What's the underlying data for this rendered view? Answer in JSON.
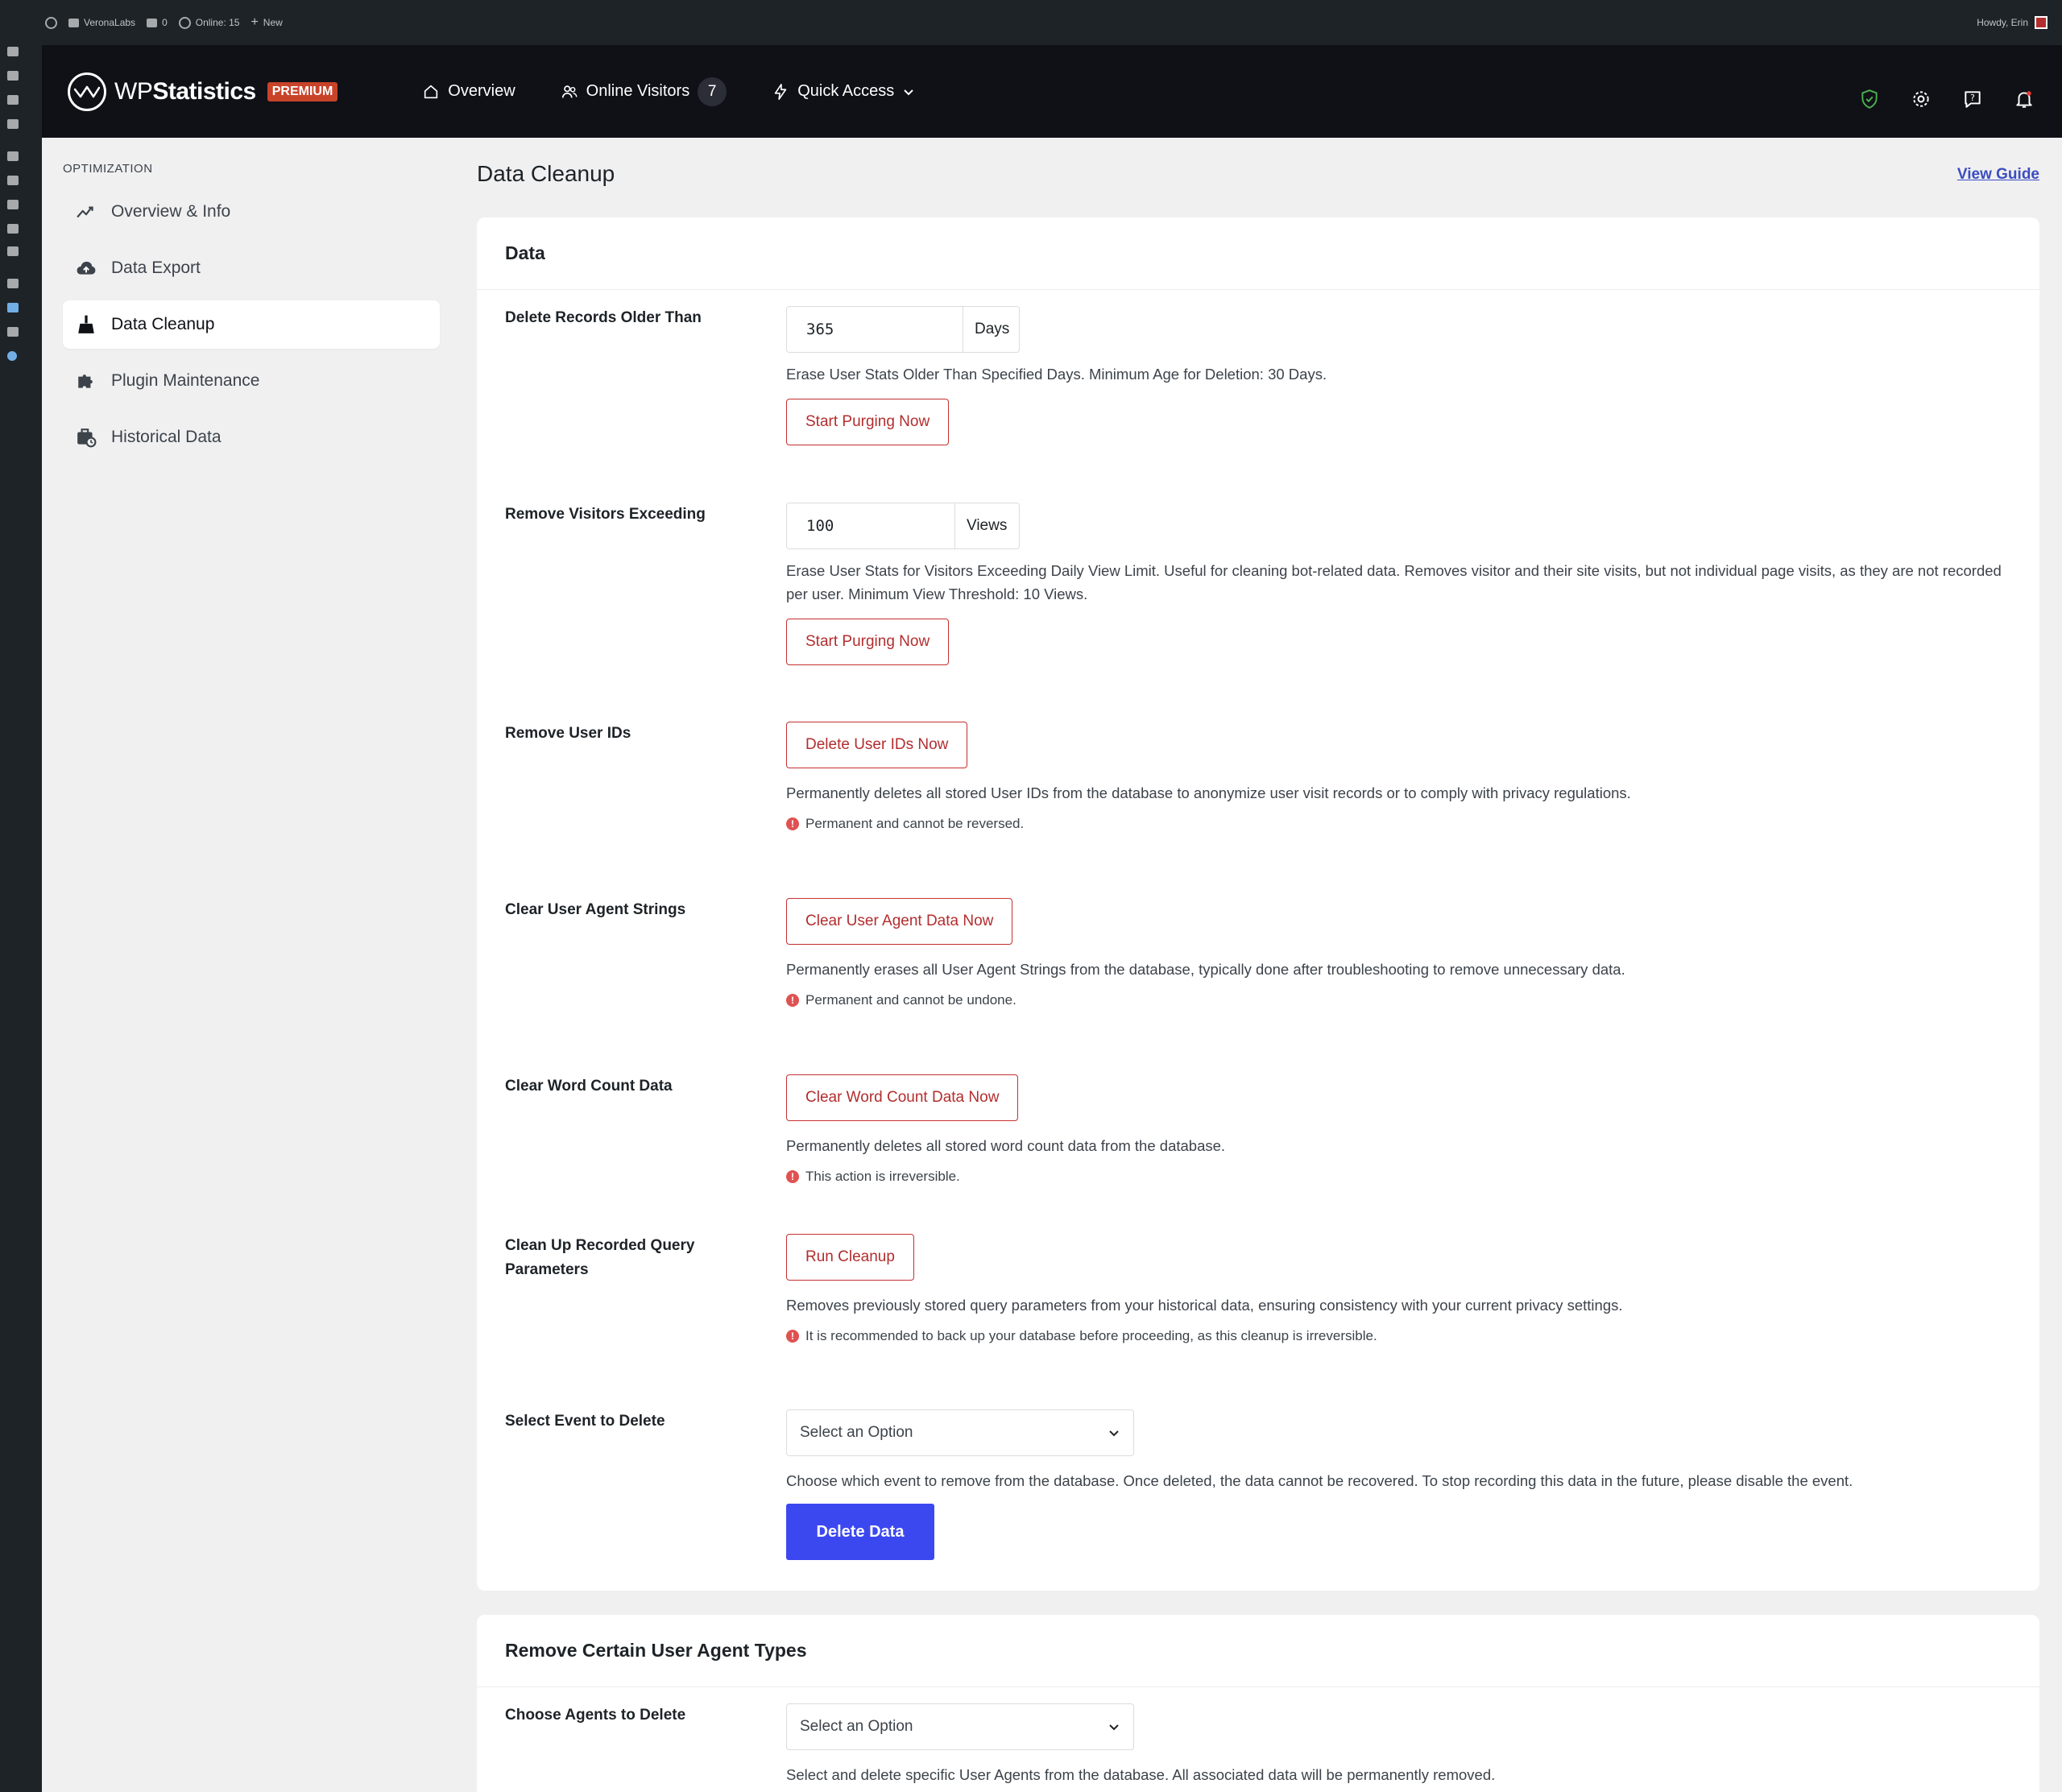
{
  "adminbar": {
    "site_name": "VeronaLabs",
    "comments_count": "0",
    "online": "Online: 15",
    "new_label": "New",
    "howdy": "Howdy, Erin"
  },
  "brand": {
    "name_light": "WP",
    "name_bold": "Statistics",
    "badge": "PREMIUM"
  },
  "topnav": {
    "overview": "Overview",
    "online_visitors": "Online Visitors",
    "online_count": "7",
    "quick_access": "Quick Access"
  },
  "sidebar": {
    "heading": "OPTIMIZATION",
    "items": [
      {
        "label": "Overview & Info",
        "icon": "trend-icon"
      },
      {
        "label": "Data Export",
        "icon": "cloud-upload-icon"
      },
      {
        "label": "Data Cleanup",
        "icon": "broom-icon"
      },
      {
        "label": "Plugin Maintenance",
        "icon": "puzzle-icon"
      },
      {
        "label": "Historical Data",
        "icon": "briefcase-clock-icon"
      }
    ],
    "active_index": 2
  },
  "page": {
    "title": "Data Cleanup",
    "view_guide": "View Guide"
  },
  "data_card": {
    "title": "Data",
    "delete_older": {
      "label": "Delete Records Older Than",
      "value": "365",
      "suffix": "Days",
      "description": "Erase User Stats Older Than Specified Days. Minimum Age for Deletion: 30 Days.",
      "button": "Start Purging Now"
    },
    "remove_visitors": {
      "label": "Remove Visitors Exceeding",
      "value": "100",
      "suffix": "Views",
      "description": "Erase User Stats for Visitors Exceeding Daily View Limit. Useful for cleaning bot-related data. Removes visitor and their site visits, but not individual page visits, as they are not recorded per user. Minimum View Threshold: 10 Views.",
      "button": "Start Purging Now"
    },
    "remove_user_ids": {
      "label": "Remove User IDs",
      "button": "Delete User IDs Now",
      "description": "Permanently deletes all stored User IDs from the database to anonymize user visit records or to comply with privacy regulations.",
      "warning": "Permanent and cannot be reversed."
    },
    "clear_user_agent": {
      "label": "Clear User Agent Strings",
      "button": "Clear User Agent Data Now",
      "description": "Permanently erases all User Agent Strings from the database, typically done after troubleshooting to remove unnecessary data.",
      "warning": "Permanent and cannot be undone."
    },
    "clear_word_count": {
      "label": "Clear Word Count Data",
      "button": "Clear Word Count Data Now",
      "description": "Permanently deletes all stored word count data from the database.",
      "warning": "This action is irreversible."
    },
    "query_params": {
      "label": "Clean Up Recorded Query Parameters",
      "button": "Run Cleanup",
      "description": "Removes previously stored query parameters from your historical data, ensuring consistency with your current privacy settings.",
      "warning": "It is recommended to back up your database before proceeding, as this cleanup is irreversible."
    },
    "select_event": {
      "label": "Select Event to Delete",
      "selected": "Select an Option",
      "description": "Choose which event to remove from the database. Once deleted, the data cannot be recovered. To stop recording this data in the future, please disable the event.",
      "button": "Delete Data"
    }
  },
  "agents_card": {
    "title": "Remove Certain User Agent Types",
    "choose_agents": {
      "label": "Choose Agents to Delete",
      "selected": "Select an Option",
      "description": "Select and delete specific User Agents from the database. All associated data will be permanently removed."
    }
  },
  "colors": {
    "header_bg": "#0f1117",
    "wp_bar": "#1d2327",
    "danger": "#b32d2e",
    "primary": "#3c48ef",
    "premium": "#c8432a"
  }
}
